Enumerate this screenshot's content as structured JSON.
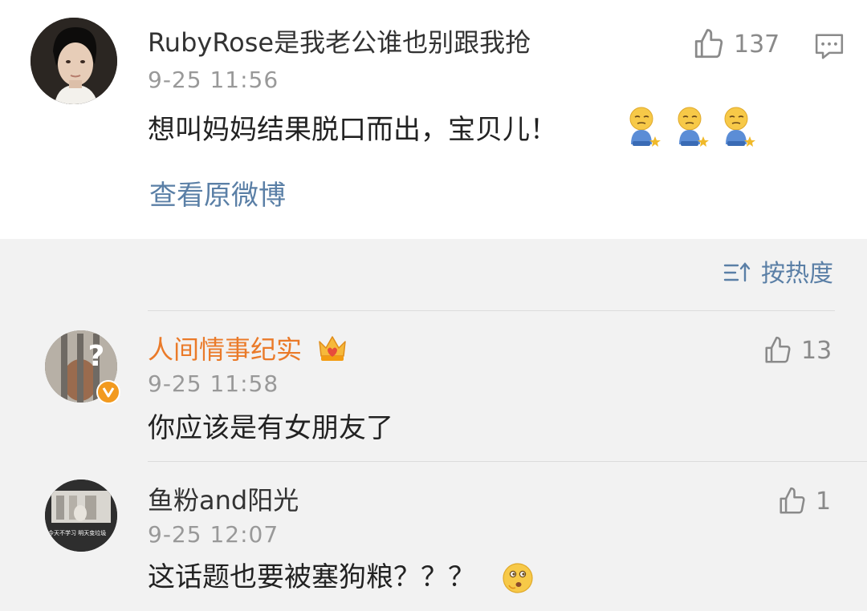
{
  "colors": {
    "page_bg": "#f2f2f2",
    "post_bg": "#ffffff",
    "text": "#222222",
    "meta_gray": "#999999",
    "link_blue": "#5a7fa6",
    "vip_orange": "#ea7a29"
  },
  "post": {
    "user": "RubyRose是我老公谁也别跟我抢",
    "time": "9-25 11:56",
    "text": "想叫妈妈结果脱口而出，宝贝儿！",
    "emojis": [
      "wronged-emoji",
      "wronged-emoji",
      "wronged-emoji"
    ],
    "likes": "137",
    "view_original": "查看原微博"
  },
  "sort": {
    "label": "按热度",
    "icon": "sort-icon"
  },
  "comments": [
    {
      "user": "人间情事纪实",
      "badge": "vip-crown-icon",
      "verified": "verified-v-icon",
      "time": "9-25 11:58",
      "text": "你应该是有女朋友了",
      "likes": "13"
    },
    {
      "user": "鱼粉and阳光",
      "time": "9-25 12:07",
      "text": "这话题也要被塞狗粮？？？",
      "emoji": "thinking-emoji",
      "likes": "1",
      "avatar_caption": "今天不学习 明天变垃圾"
    }
  ]
}
